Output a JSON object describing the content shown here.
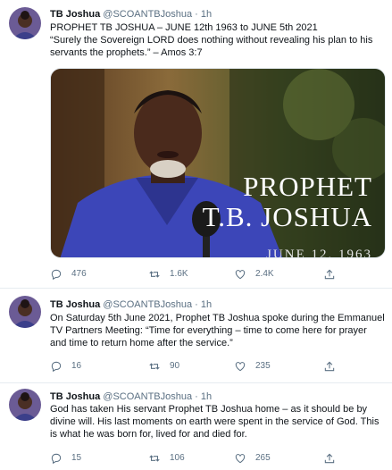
{
  "tweets": [
    {
      "name": "TB Joshua",
      "handle": "@SCOANTBJoshua",
      "dot": "·",
      "time": "1h",
      "text_lines": [
        "PROPHET TB JOSHUA – JUNE 12th 1963 to JUNE 5th 2021",
        "“Surely the Sovereign LORD does nothing without revealing his plan to his",
        "servants the prophets.” – Amos 3:7"
      ],
      "media": {
        "overlay_line1": "PROPHET",
        "overlay_line2": "T.B. JOSHUA",
        "overlay_line3": "JUNE 12, 1963"
      },
      "replies": "476",
      "retweets": "1.6K",
      "likes": "2.4K"
    },
    {
      "name": "TB Joshua",
      "handle": "@SCOANTBJoshua",
      "dot": "·",
      "time": "1h",
      "text_lines": [
        "On Saturday 5th June 2021, Prophet TB Joshua spoke during the Emmanuel",
        "TV Partners Meeting: “Time for everything – time to come here for prayer",
        "and time to return home after the service.”"
      ],
      "replies": "16",
      "retweets": "90",
      "likes": "235"
    },
    {
      "name": "TB Joshua",
      "handle": "@SCOANTBJoshua",
      "dot": "·",
      "time": "1h",
      "text_lines": [
        "God has taken His servant Prophet TB Joshua home – as it should be by",
        "divine will. His last moments on earth were spent in the service of God. This",
        "is what he was born for, lived for and died for."
      ],
      "replies": "15",
      "retweets": "106",
      "likes": "265"
    }
  ],
  "icons": {
    "reply": "reply-icon",
    "retweet": "retweet-icon",
    "like": "heart-icon",
    "share": "share-icon"
  },
  "colors": {
    "muted": "#5b7083",
    "divider": "#e6ecf0",
    "text": "#0f1419"
  }
}
